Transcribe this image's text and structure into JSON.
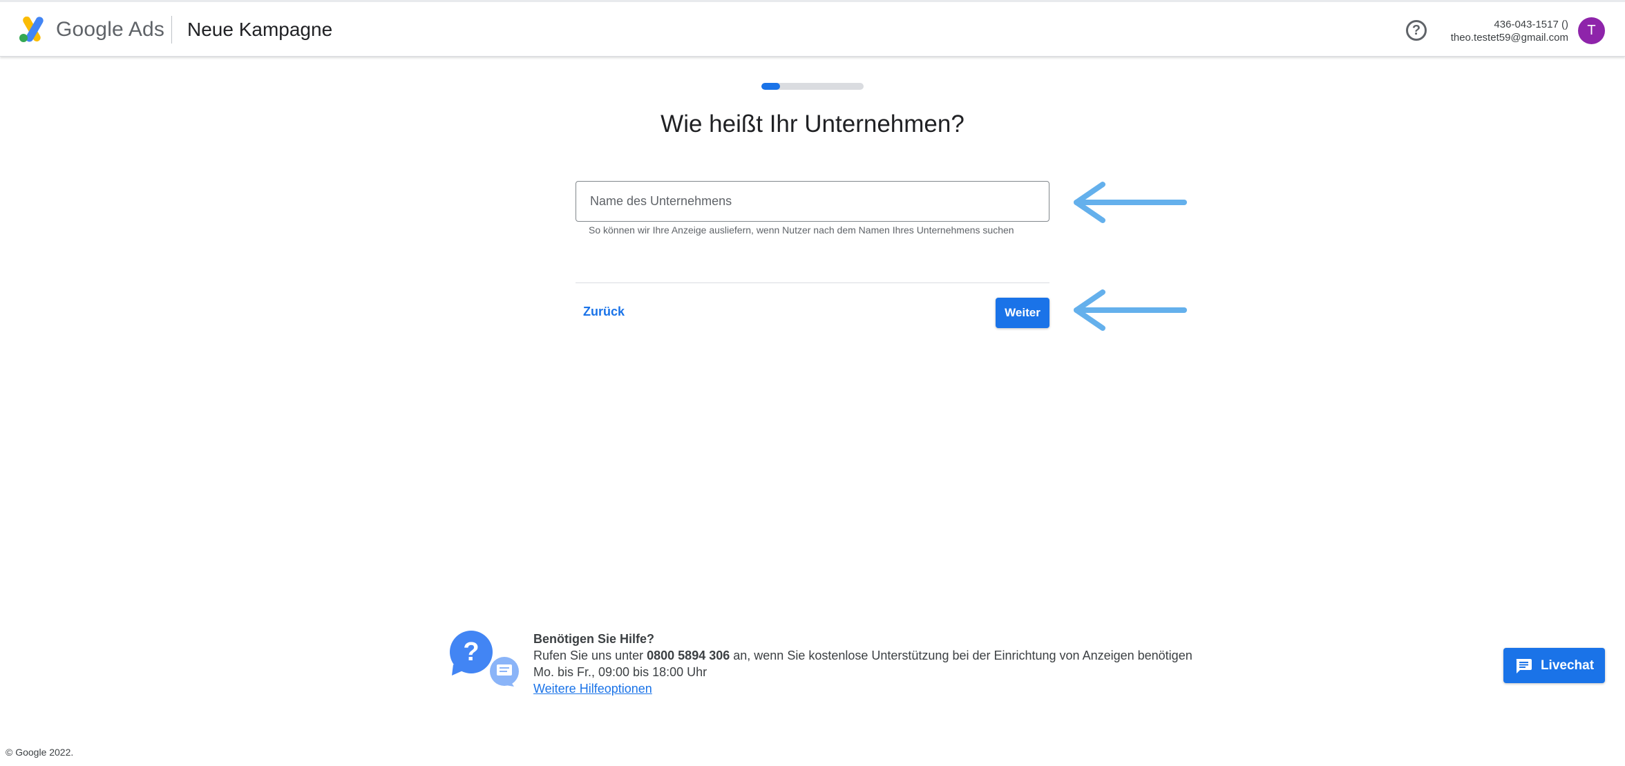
{
  "header": {
    "brand": "Google Ads",
    "title": "Neue Kampagne",
    "help_icon": "help-circle-icon",
    "account_id": "436-043-1517 ()",
    "account_email": "theo.testet59@gmail.com",
    "avatar_initial": "T",
    "avatar_color": "#8e24aa"
  },
  "progress": {
    "fraction": 0.18
  },
  "main": {
    "question": "Wie heißt Ihr Unternehmen?",
    "business_name_placeholder": "Name des Unternehmens",
    "business_name_value": "",
    "hint": "So können wir Ihre Anzeige ausliefern, wenn Nutzer nach dem Namen Ihres Unternehmens suchen",
    "back_label": "Zurück",
    "next_label": "Weiter"
  },
  "help": {
    "title": "Benötigen Sie Hilfe?",
    "line1_prefix": "Rufen Sie uns unter",
    "phone": "0800 5894 306",
    "line1_suffix": "an, wenn Sie kostenlose Unterstützung bei der Einrichtung von Anzeigen benötigen",
    "hours": "Mo. bis Fr., 09:00 bis 18:00 Uhr",
    "more_options": "Weitere Hilfeoptionen"
  },
  "livechat": {
    "label": "Livechat",
    "icon": "chat-icon"
  },
  "footer": {
    "copyright": "© Google 2022."
  },
  "colors": {
    "accent": "#1a73e8",
    "annotation_arrow": "#64b0ec"
  }
}
